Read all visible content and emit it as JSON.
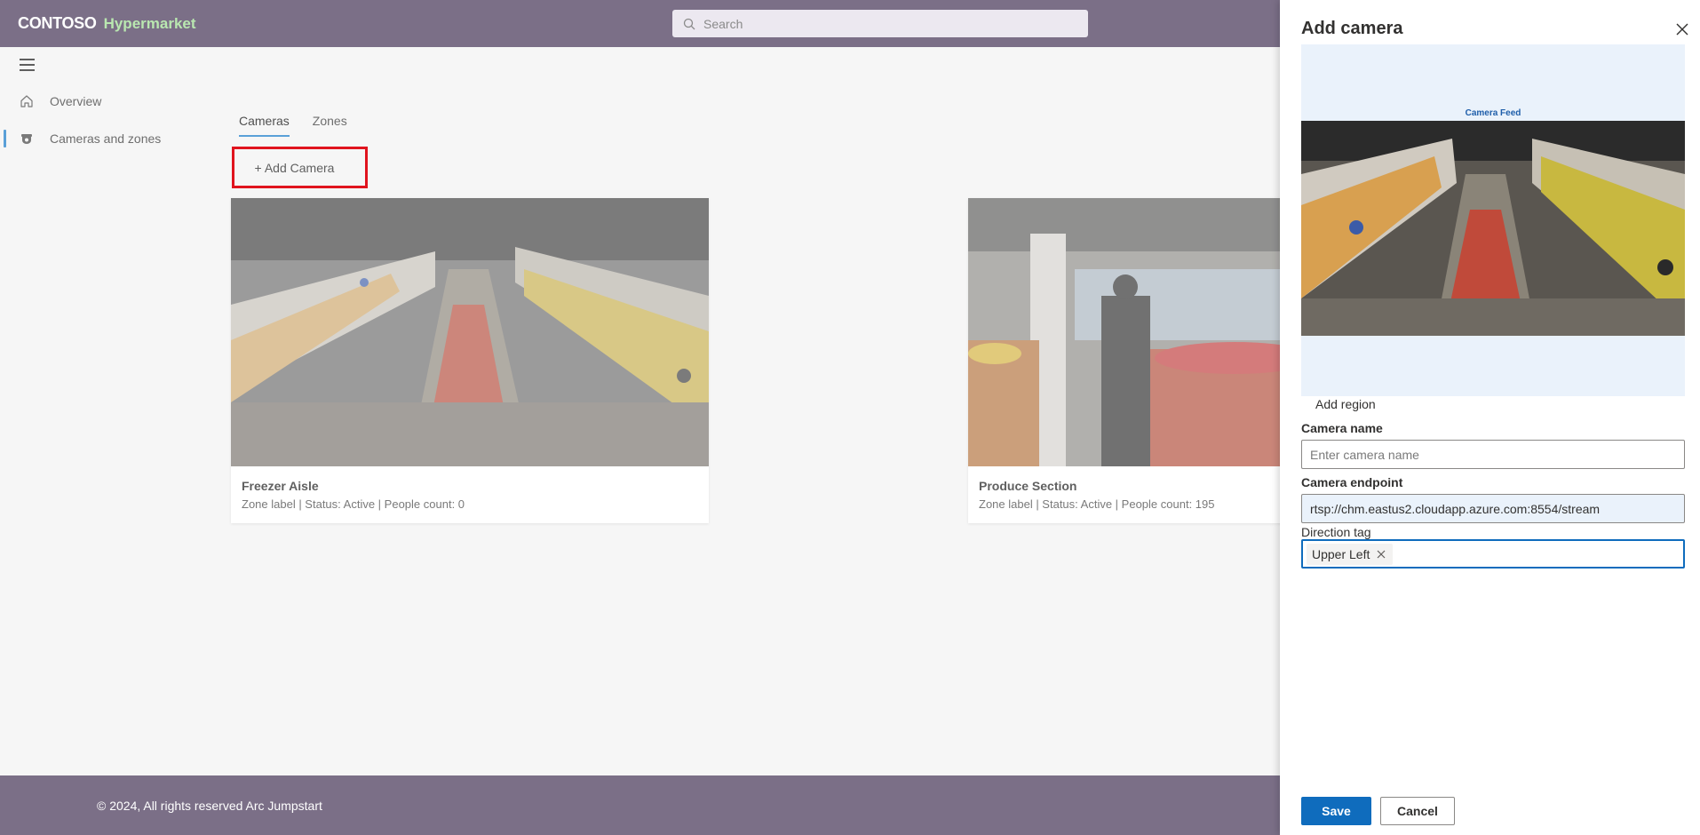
{
  "header": {
    "brand": "CONTOSO",
    "brand_sub": "Hypermarket",
    "search_placeholder": "Search"
  },
  "sidebar": {
    "items": [
      {
        "label": "Overview",
        "icon": "home-icon"
      },
      {
        "label": "Cameras and zones",
        "icon": "camera-icon"
      }
    ]
  },
  "main": {
    "tabs": [
      {
        "label": "Cameras"
      },
      {
        "label": "Zones"
      }
    ],
    "add_camera_label": "+ Add Camera",
    "cards": [
      {
        "title": "Freezer Aisle",
        "meta": "Zone label  | Status: Active | People count: 0"
      },
      {
        "title": "Produce Section",
        "meta": "Zone label  | Status: Active | People count: 195"
      }
    ]
  },
  "footer": {
    "copyright": "© 2024, All rights reserved Arc Jumpstart"
  },
  "panel": {
    "title": "Add camera",
    "feed_label": "Camera Feed",
    "add_region": "Add region",
    "camera_name_label": "Camera name",
    "camera_name_placeholder": "Enter camera name",
    "camera_endpoint_label": "Camera endpoint",
    "camera_endpoint_value": "rtsp://chm.eastus2.cloudapp.azure.com:8554/stream",
    "direction_tag_label": "Direction tag",
    "direction_tag_value": "Upper Left",
    "save_label": "Save",
    "cancel_label": "Cancel"
  },
  "colors": {
    "topbar": "#7b6f87",
    "accent": "#0f6cbd",
    "highlight_outline": "#e0141e",
    "brand_sub": "#b9e7b0"
  }
}
